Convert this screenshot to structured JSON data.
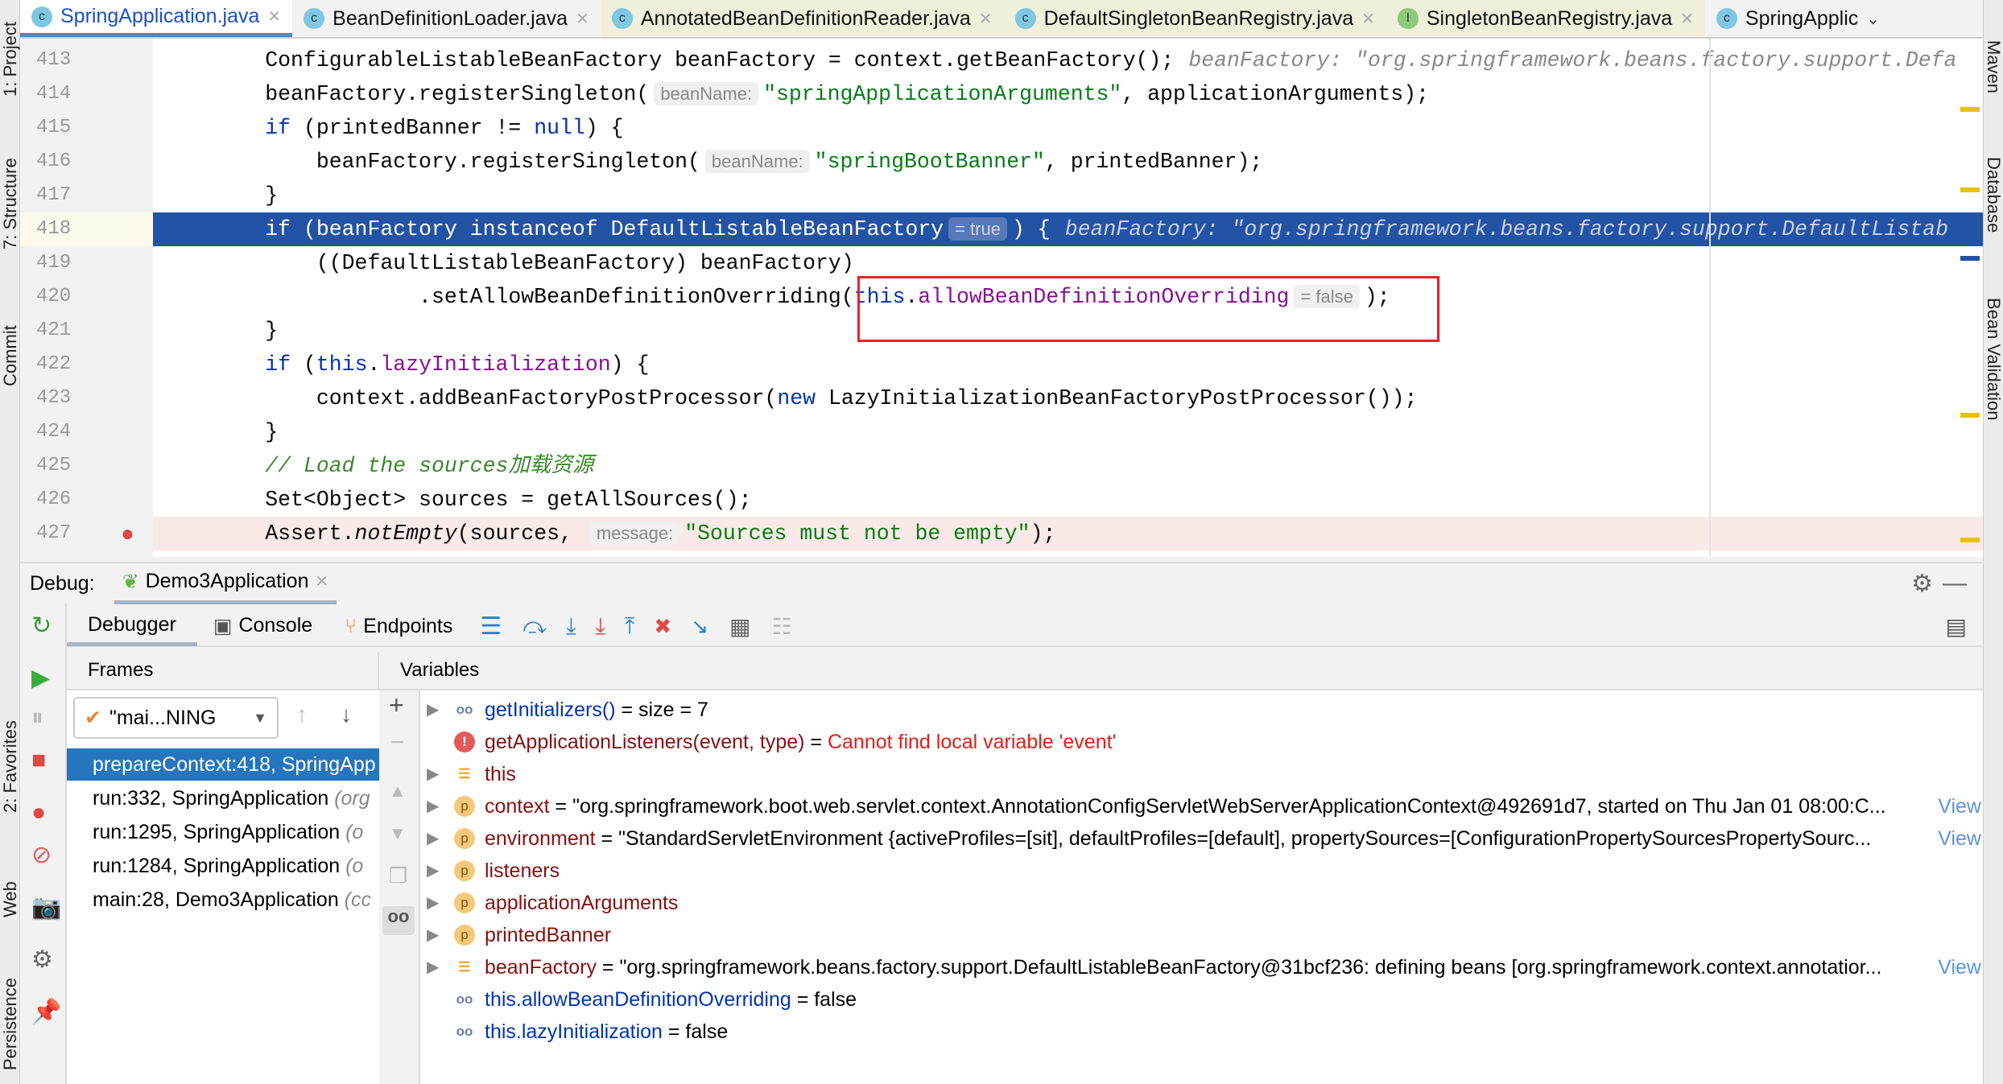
{
  "tabs": [
    {
      "label": "SpringApplication.java",
      "icon": "class-icon",
      "active": true
    },
    {
      "label": "BeanDefinitionLoader.java",
      "icon": "class-icon"
    },
    {
      "label": "AnnotatedBeanDefinitionReader.java",
      "icon": "class-icon",
      "pinned": true
    },
    {
      "label": "DefaultSingletonBeanRegistry.java",
      "icon": "class-icon",
      "pinned": true
    },
    {
      "label": "SingletonBeanRegistry.java",
      "icon": "interface-icon",
      "pinned": true
    },
    {
      "label": "SpringApplic",
      "icon": "class-icon"
    }
  ],
  "left_strip": [
    "1: Project",
    "7: Structure",
    "Commit",
    "2: Favorites",
    "Web",
    "Persistence"
  ],
  "right_strip": [
    "Maven",
    "Database",
    "Bean Validation"
  ],
  "editor": {
    "lines": [
      {
        "n": "413",
        "tokens": [
          [
            "        ConfigurableListableBeanFactory beanFactory = context.getBeanFactory();",
            ""
          ],
          [
            "beanFactory: \"org.springframework.beans.factory.support.Defa",
            "dbg"
          ]
        ]
      },
      {
        "n": "414",
        "tokens": [
          [
            "        beanFactory.registerSingleton(",
            ""
          ],
          [
            "beanName:",
            "hint"
          ],
          [
            "\"springApplicationArguments\"",
            "str"
          ],
          [
            ", applicationArguments);",
            ""
          ]
        ]
      },
      {
        "n": "415",
        "tokens": [
          [
            "        ",
            ""
          ],
          [
            "if",
            "kw"
          ],
          [
            " (printedBanner != ",
            ""
          ],
          [
            "null",
            "kw"
          ],
          [
            ") {",
            ""
          ]
        ]
      },
      {
        "n": "416",
        "tokens": [
          [
            "            beanFactory.registerSingleton(",
            ""
          ],
          [
            "beanName:",
            "hint"
          ],
          [
            "\"springBootBanner\"",
            "str"
          ],
          [
            ", printedBanner);",
            ""
          ]
        ]
      },
      {
        "n": "417",
        "tokens": [
          [
            "        }",
            ""
          ]
        ]
      },
      {
        "n": "418",
        "selected": true,
        "tokens": [
          [
            "        ",
            ""
          ],
          [
            "if",
            "kw"
          ],
          [
            " (beanFactory ",
            ""
          ],
          [
            "instanceof",
            "kw"
          ],
          [
            " DefaultListableBeanFactory",
            ""
          ],
          [
            "= true",
            "hint"
          ],
          [
            ") {",
            ""
          ],
          [
            "beanFactory: \"org.springframework.beans.factory.support.DefaultListab",
            "dbg"
          ]
        ]
      },
      {
        "n": "419",
        "tokens": [
          [
            "            ((DefaultListableBeanFactory) beanFactory)",
            ""
          ]
        ]
      },
      {
        "n": "420",
        "tokens": [
          [
            "                    .setAllowBeanDefinitionOverriding(",
            ""
          ],
          [
            "this",
            "kw"
          ],
          [
            ".",
            ""
          ],
          [
            "allowBeanDefinitionOverriding",
            "field"
          ],
          [
            "= false",
            "hint"
          ],
          [
            ");",
            ""
          ]
        ]
      },
      {
        "n": "421",
        "tokens": [
          [
            "        }",
            ""
          ]
        ]
      },
      {
        "n": "422",
        "tokens": [
          [
            "        ",
            ""
          ],
          [
            "if",
            "kw"
          ],
          [
            " (",
            ""
          ],
          [
            "this",
            "kw"
          ],
          [
            ".",
            ""
          ],
          [
            "lazyInitialization",
            "field"
          ],
          [
            ") {",
            ""
          ]
        ]
      },
      {
        "n": "423",
        "tokens": [
          [
            "            context.addBeanFactoryPostProcessor(",
            ""
          ],
          [
            "new",
            "kw"
          ],
          [
            " LazyInitializationBeanFactoryPostProcessor());",
            ""
          ]
        ]
      },
      {
        "n": "424",
        "tokens": [
          [
            "        }",
            ""
          ]
        ]
      },
      {
        "n": "425",
        "tokens": [
          [
            "        ",
            ""
          ],
          [
            "// Load the sources加载资源",
            "com"
          ]
        ]
      },
      {
        "n": "426",
        "tokens": [
          [
            "        Set<Object> sources = getAllSources();",
            ""
          ]
        ]
      },
      {
        "n": "427",
        "breakpoint": true,
        "tokens": [
          [
            "        Assert.",
            ""
          ],
          [
            "notEmpty",
            "it"
          ],
          [
            "(sources, ",
            ""
          ],
          [
            "message:",
            "hint"
          ],
          [
            "\"Sources must not be empty\"",
            "str"
          ],
          [
            ");",
            ""
          ]
        ]
      }
    ]
  },
  "debug": {
    "label": "Debug:",
    "session": "Demo3Application",
    "tabs": [
      "Debugger",
      "Console",
      "Endpoints"
    ],
    "frames_title": "Frames",
    "variables_title": "Variables",
    "thread": "\"mai...NING",
    "frames": [
      {
        "method": "prepareContext:418, SpringApp",
        "pkg": "",
        "selected": true
      },
      {
        "method": "run:332, SpringApplication ",
        "pkg": "(org"
      },
      {
        "method": "run:1295, SpringApplication ",
        "pkg": "(o"
      },
      {
        "method": "run:1284, SpringApplication ",
        "pkg": "(o"
      },
      {
        "method": "main:28, Demo3Application ",
        "pkg": "(cc"
      }
    ],
    "variables": [
      {
        "expand": true,
        "icon": "watch",
        "name": "getInitializers()",
        "watch": true,
        "value": " =  size = 7"
      },
      {
        "expand": false,
        "icon": "err",
        "name": "getApplicationListeners(event, type)",
        "value": " = ",
        "error": "Cannot find local variable 'event'"
      },
      {
        "expand": true,
        "icon": "list",
        "name": "this",
        "value": ""
      },
      {
        "expand": true,
        "icon": "p",
        "name": "context",
        "value": " = \"org.springframework.boot.web.servlet.context.AnnotationConfigServletWebServerApplicationContext@492691d7, started on Thu Jan 01 08:00:C...",
        "view": "View"
      },
      {
        "expand": true,
        "icon": "p",
        "name": "environment",
        "value": " = \"StandardServletEnvironment {activeProfiles=[sit], defaultProfiles=[default], propertySources=[ConfigurationPropertySourcesPropertySourc...",
        "view": "View"
      },
      {
        "expand": true,
        "icon": "p",
        "name": "listeners",
        "value": ""
      },
      {
        "expand": true,
        "icon": "p",
        "name": "applicationArguments",
        "value": ""
      },
      {
        "expand": true,
        "icon": "p",
        "name": "printedBanner",
        "value": ""
      },
      {
        "expand": true,
        "icon": "list",
        "name": "beanFactory",
        "value": " = \"org.springframework.beans.factory.support.DefaultListableBeanFactory@31bcf236: defining beans [org.springframework.context.annotatior...",
        "view": "View"
      },
      {
        "expand": false,
        "icon": "watch",
        "name": "this.allowBeanDefinitionOverriding",
        "watch": true,
        "value": " = false"
      },
      {
        "expand": false,
        "icon": "watch",
        "name": "this.lazyInitialization",
        "watch": true,
        "value": " = false"
      }
    ]
  },
  "colors": {
    "selection": "#2253a5",
    "frame_selected": "#2675bf",
    "highlight_box": "#e8202a",
    "breakpoint_line": "#faeae7"
  }
}
